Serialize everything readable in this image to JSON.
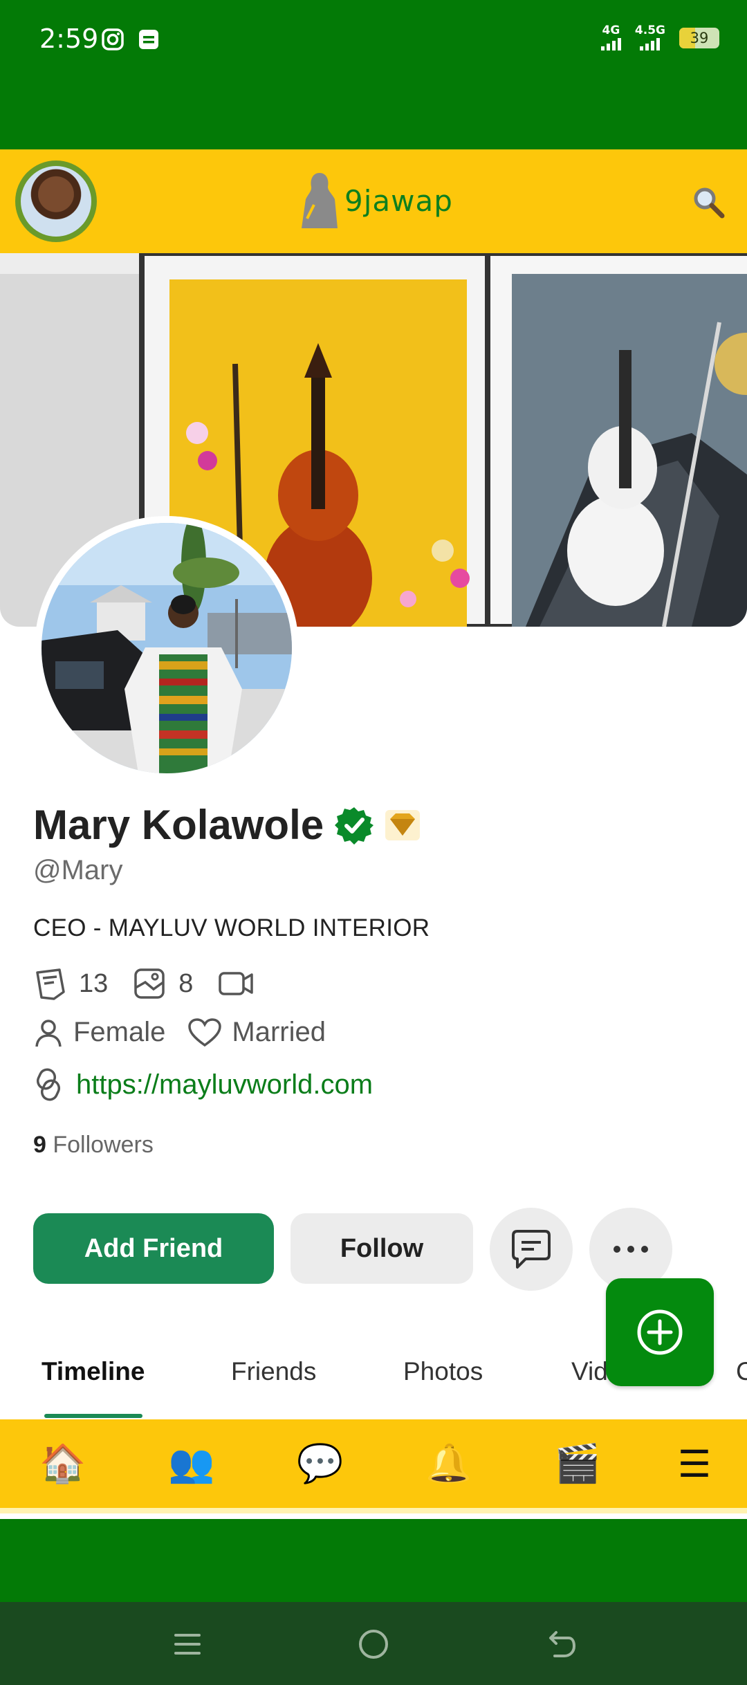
{
  "status_bar": {
    "time": "2:59",
    "network_1": "4G",
    "network_2": "4.5G",
    "battery": "39",
    "battery_level": 0.39
  },
  "header": {
    "logo_text": "9jawap",
    "icons": [
      "avatar",
      "logo-icon",
      "search-icon"
    ]
  },
  "profile": {
    "name": "Mary Kolawole",
    "handle": "@Mary",
    "bio": "CEO - MAYLUV WORLD INTERIOR",
    "posts_count": "13",
    "albums_count": "8",
    "gender": "Female",
    "relationship": "Married",
    "website": "https://mayluvworld.com",
    "followers_count": "9",
    "followers_label": "Followers"
  },
  "actions": {
    "add_friend": "Add Friend",
    "follow": "Follow"
  },
  "tabs": [
    {
      "label": "Timeline",
      "active": true
    },
    {
      "label": "Friends"
    },
    {
      "label": "Photos"
    },
    {
      "label": "Vid"
    },
    {
      "label": "C"
    }
  ],
  "bottom_nav": {
    "home": "🏠",
    "friends": "👥",
    "messages": "💬",
    "notifications": "🔔",
    "videos": "🎬",
    "menu": "☰"
  },
  "colors": {
    "brand_green": "#037a06",
    "brand_yellow": "#fdc70b",
    "button_green": "#1b8a55",
    "link_green": "#0b7d1a"
  }
}
